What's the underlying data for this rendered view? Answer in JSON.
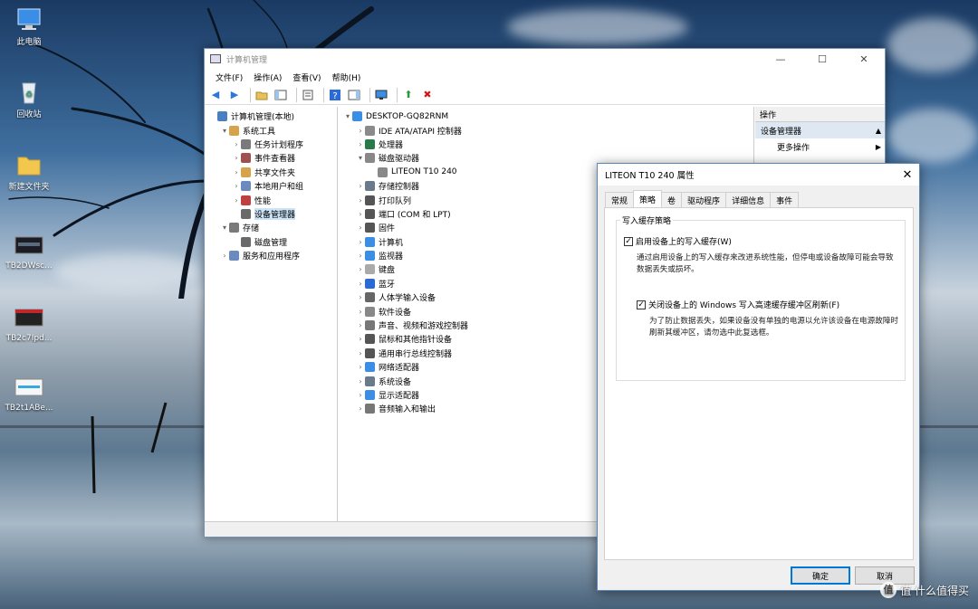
{
  "desktop": {
    "icons": [
      {
        "label": "此电脑",
        "icon": "computer-icon"
      },
      {
        "label": "回收站",
        "icon": "recycle-bin-icon"
      },
      {
        "label": "新建文件夹",
        "icon": "folder-icon"
      },
      {
        "label": "TB2DWsc...",
        "icon": "image-file-icon"
      },
      {
        "label": "TB2c7Ipd...",
        "icon": "image-file-icon"
      },
      {
        "label": "TB2t1ABe...",
        "icon": "image-file-icon"
      }
    ],
    "watermark": "值 什么值得买"
  },
  "main_window": {
    "title": "计算机管理",
    "menu": [
      "文件(F)",
      "操作(A)",
      "查看(V)",
      "帮助(H)"
    ],
    "left_tree": [
      {
        "label": "计算机管理(本地)",
        "indent": 0,
        "arrow": ""
      },
      {
        "label": "系统工具",
        "indent": 1,
        "arrow": "▾"
      },
      {
        "label": "任务计划程序",
        "indent": 2,
        "arrow": "›"
      },
      {
        "label": "事件查看器",
        "indent": 2,
        "arrow": "›"
      },
      {
        "label": "共享文件夹",
        "indent": 2,
        "arrow": "›"
      },
      {
        "label": "本地用户和组",
        "indent": 2,
        "arrow": "›"
      },
      {
        "label": "性能",
        "indent": 2,
        "arrow": "›"
      },
      {
        "label": "设备管理器",
        "indent": 2,
        "arrow": "",
        "selected": true
      },
      {
        "label": "存储",
        "indent": 1,
        "arrow": "▾"
      },
      {
        "label": "磁盘管理",
        "indent": 2,
        "arrow": ""
      },
      {
        "label": "服务和应用程序",
        "indent": 1,
        "arrow": "›"
      }
    ],
    "device_tree": [
      {
        "label": "DESKTOP-GQ82RNM",
        "indent": 0,
        "arrow": "▾"
      },
      {
        "label": "IDE ATA/ATAPI 控制器",
        "indent": 1,
        "arrow": "›"
      },
      {
        "label": "处理器",
        "indent": 1,
        "arrow": "›"
      },
      {
        "label": "磁盘驱动器",
        "indent": 1,
        "arrow": "▾"
      },
      {
        "label": "LITEON T10 240",
        "indent": 2,
        "arrow": ""
      },
      {
        "label": "存储控制器",
        "indent": 1,
        "arrow": "›"
      },
      {
        "label": "打印队列",
        "indent": 1,
        "arrow": "›"
      },
      {
        "label": "端口 (COM 和 LPT)",
        "indent": 1,
        "arrow": "›"
      },
      {
        "label": "固件",
        "indent": 1,
        "arrow": "›"
      },
      {
        "label": "计算机",
        "indent": 1,
        "arrow": "›"
      },
      {
        "label": "监视器",
        "indent": 1,
        "arrow": "›"
      },
      {
        "label": "键盘",
        "indent": 1,
        "arrow": "›"
      },
      {
        "label": "蓝牙",
        "indent": 1,
        "arrow": "›"
      },
      {
        "label": "人体学输入设备",
        "indent": 1,
        "arrow": "›"
      },
      {
        "label": "软件设备",
        "indent": 1,
        "arrow": "›"
      },
      {
        "label": "声音、视频和游戏控制器",
        "indent": 1,
        "arrow": "›"
      },
      {
        "label": "鼠标和其他指针设备",
        "indent": 1,
        "arrow": "›"
      },
      {
        "label": "通用串行总线控制器",
        "indent": 1,
        "arrow": "›"
      },
      {
        "label": "网络适配器",
        "indent": 1,
        "arrow": "›"
      },
      {
        "label": "系统设备",
        "indent": 1,
        "arrow": "›"
      },
      {
        "label": "显示适配器",
        "indent": 1,
        "arrow": "›"
      },
      {
        "label": "音频输入和输出",
        "indent": 1,
        "arrow": "›"
      }
    ],
    "actions": {
      "header": "操作",
      "section": "设备管理器",
      "more": "更多操作"
    }
  },
  "dialog": {
    "title": "LITEON T10 240 属性",
    "tabs": [
      "常规",
      "策略",
      "卷",
      "驱动程序",
      "详细信息",
      "事件"
    ],
    "active_tab": "策略",
    "group_title": "写入缓存策略",
    "option1": {
      "label": "启用设备上的写入缓存(W)",
      "checked": true,
      "description": "通过启用设备上的写入缓存来改进系统性能，但停电或设备故障可能会导致数据丢失或损坏。"
    },
    "option2": {
      "label": "关闭设备上的 Windows 写入高速缓存缓冲区刷新(F)",
      "checked": true,
      "description": "为了防止数据丢失，如果设备没有单独的电源以允许该设备在电源故障时刷新其缓冲区，请勿选中此复选框。"
    },
    "ok": "确定",
    "cancel": "取消"
  }
}
